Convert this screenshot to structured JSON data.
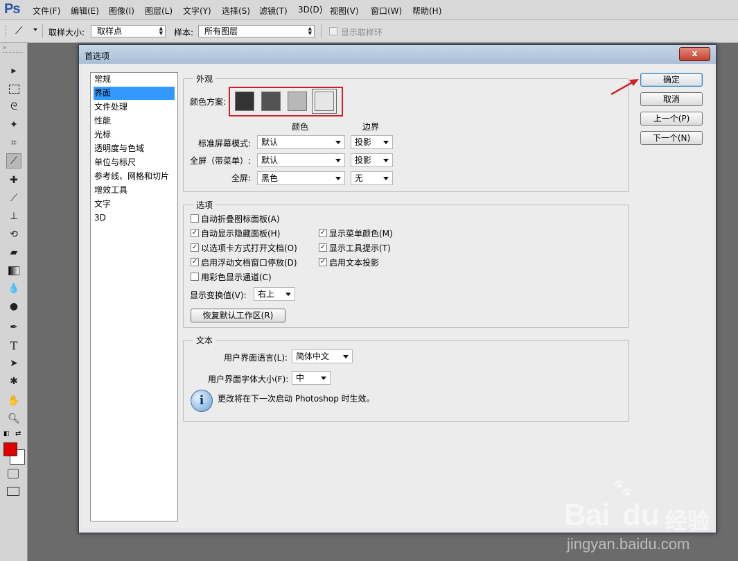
{
  "app": {
    "logo": "Ps"
  },
  "menubar": {
    "items": [
      "文件(F)",
      "编辑(E)",
      "图像(I)",
      "图层(L)",
      "文字(Y)",
      "选择(S)",
      "滤镜(T)",
      "3D(D)",
      "视图(V)",
      "窗口(W)",
      "帮助(H)"
    ]
  },
  "options_bar": {
    "sample_size_label": "取样大小:",
    "sample_size_value": "取样点",
    "sample_label": "样本:",
    "sample_value": "所有图层",
    "show_ring_label": "显示取样环"
  },
  "dialog": {
    "title": "首选项",
    "close_label": "x",
    "buttons": {
      "ok": "确定",
      "cancel": "取消",
      "prev": "上一个(P)",
      "next": "下一个(N)"
    },
    "sidebar": {
      "selected_index": 1,
      "items": [
        "常规",
        "界面",
        "文件处理",
        "性能",
        "光标",
        "透明度与色域",
        "单位与标尺",
        "参考线、网格和切片",
        "增效工具",
        "文字",
        "3D"
      ]
    },
    "appearance": {
      "legend": "外观",
      "scheme_label": "颜色方案:",
      "swatch_colors": [
        "#333333",
        "#535353",
        "#b8b8b8",
        "#e6e6e6"
      ],
      "col_color": "颜色",
      "col_border": "边界",
      "rows": [
        {
          "label": "标准屏幕模式:",
          "color": "默认",
          "border": "投影"
        },
        {
          "label": "全屏（带菜单）:",
          "color": "默认",
          "border": "投影"
        },
        {
          "label": "全屏:",
          "color": "黑色",
          "border": "无"
        }
      ]
    },
    "options": {
      "legend": "选项",
      "checks_left": [
        {
          "label": "自动折叠图标面板(A)",
          "checked": false
        },
        {
          "label": "自动显示隐藏面板(H)",
          "checked": true
        },
        {
          "label": "以选项卡方式打开文档(O)",
          "checked": true
        },
        {
          "label": "启用浮动文档窗口停放(D)",
          "checked": true
        },
        {
          "label": "用彩色显示通道(C)",
          "checked": false
        }
      ],
      "checks_right": [
        {
          "label": "显示菜单颜色(M)",
          "checked": true
        },
        {
          "label": "显示工具提示(T)",
          "checked": true
        },
        {
          "label": "启用文本投影",
          "checked": true
        }
      ],
      "transform_label": "显示变换值(V):",
      "transform_value": "右上",
      "reset_button": "恢复默认工作区(R)"
    },
    "text": {
      "legend": "文本",
      "lang_label": "用户界面语言(L):",
      "lang_value": "简体中文",
      "size_label": "用户界面字体大小(F):",
      "size_value": "中",
      "info": "更改将在下一次启动 Photoshop 时生效。"
    }
  },
  "watermark": {
    "brand": "Bai",
    "brand2": "du",
    "cn": "经验",
    "url": "jingyan.baidu.com"
  },
  "colors": {
    "highlight": "#d0212b",
    "arrow": "#d0212b",
    "selection": "#3399ff",
    "foreground": "#e00000",
    "background": "#ffffff"
  }
}
